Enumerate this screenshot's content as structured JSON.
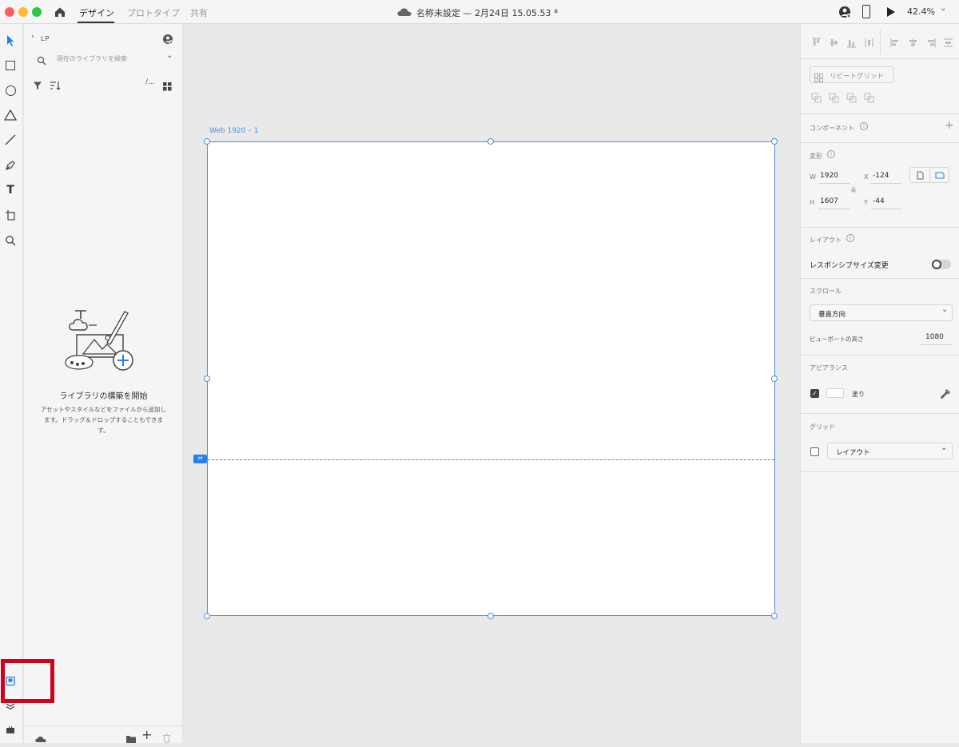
{
  "titlebar": {
    "tab_design": "デザイン",
    "tab_prototype": "プロトタイプ",
    "tab_share": "共有",
    "doc_title": "名称未設定 — 2月24日 15.05.53 *",
    "zoom": "42.4%"
  },
  "library": {
    "back_label": "LP",
    "search_placeholder": "現在のライブラリを検索",
    "view_toggle": "/...",
    "empty_title": "ライブラリの構築を開始",
    "empty_desc": "アセットやスタイルなどをファイルから追加します。ドラッグ＆ドロップすることもできます。"
  },
  "canvas": {
    "artboard_label": "Web 1920 – 1"
  },
  "props": {
    "repeat_grid": "リピートグリッド",
    "component": "コンポーネント",
    "transform": "変形",
    "w_label": "W",
    "w_value": "1920",
    "x_label": "X",
    "x_value": "-124",
    "h_label": "H",
    "h_value": "1607",
    "y_label": "Y",
    "y_value": "-44",
    "layout": "レイアウト",
    "responsive": "レスポンシブサイズ変更",
    "scroll": "スクロール",
    "scroll_value": "垂直方向",
    "viewport_label": "ビューポートの高さ",
    "viewport_value": "1080",
    "appearance": "アピアランス",
    "fill_label": "塗り",
    "grid": "グリッド",
    "grid_value": "レイアウト"
  },
  "colors": {
    "accent": "#2680eb",
    "artboard_border": "#4a90d9",
    "highlight": "#d0021b"
  }
}
